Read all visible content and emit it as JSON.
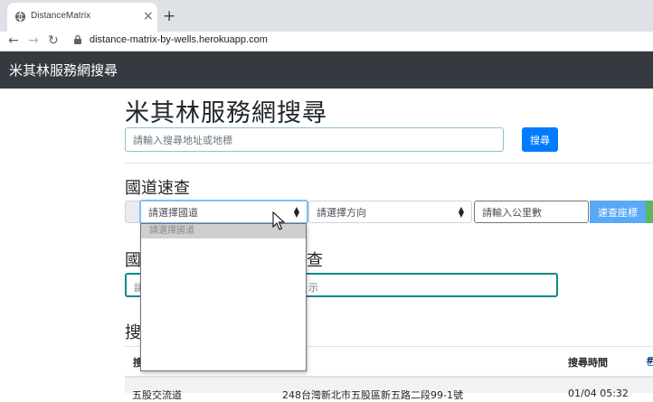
{
  "browser": {
    "tab_title": "DistanceMatrix",
    "url": "distance-matrix-by-wells.herokuapp.com"
  },
  "navbar": {
    "brand": "米其林服務網搜尋"
  },
  "search": {
    "heading": "米其林服務網搜尋",
    "placeholder": "請輸入搜尋地址或地標",
    "button": "搜尋"
  },
  "highway": {
    "heading": "國道速查",
    "road_select": "請選擇國道",
    "direction_select": "請選擇方向",
    "km_placeholder": "請輸入公里數",
    "quick_button": "速查座標",
    "dropdown_options": [
      "請選擇國道"
    ]
  },
  "section2": {
    "heading_left": "國",
    "heading_right": "查",
    "input_left": "請",
    "input_right": "示"
  },
  "results": {
    "heading": "搜",
    "col_left": "搜",
    "col_time": "搜尋時間",
    "col_hash": "#",
    "row1_name": "五股交流道",
    "row1_addr": "248台灣新北市五股區新五路二段99-1號",
    "row1_time": "01/04 05:32"
  },
  "colors": {
    "navbar": "#343a40",
    "primary": "#007bff",
    "quick_button": "#5aa9f5",
    "focus_border": "#0e8a86"
  }
}
